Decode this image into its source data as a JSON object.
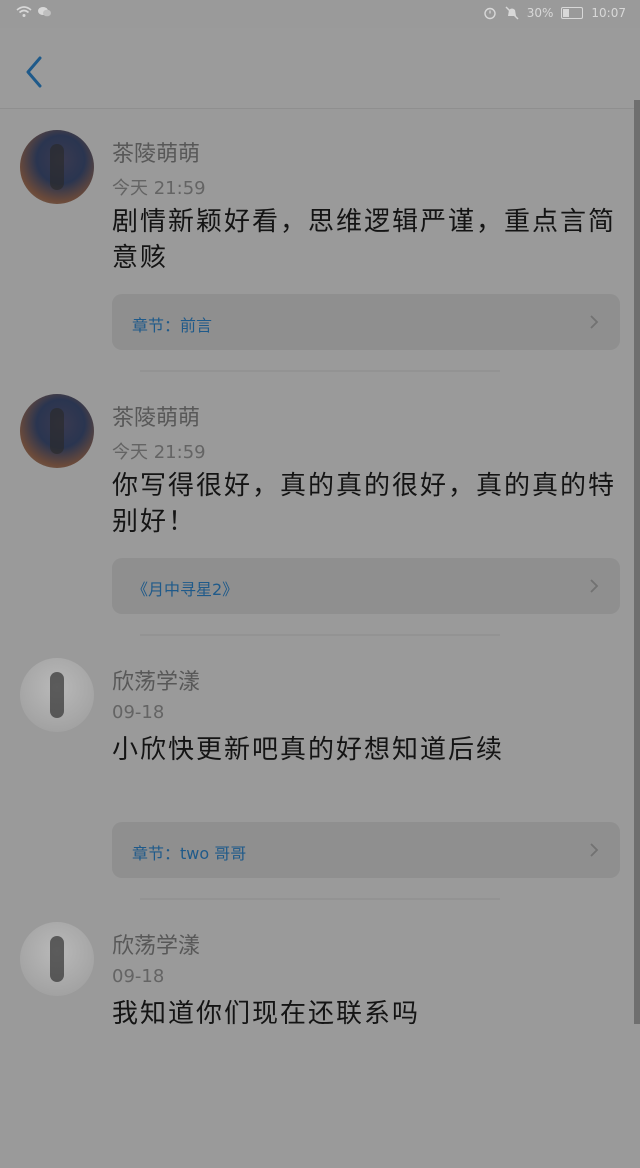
{
  "status": {
    "battery_percent": "30%",
    "time": "10:07"
  },
  "nav": {
    "back_icon": "chevron-left-icon"
  },
  "comments": [
    {
      "user": "茶陵萌萌",
      "time": "今天 21:59",
      "text": "剧情新颖好看，思维逻辑严谨，重点言简意赅",
      "chapter": "章节：前言"
    },
    {
      "user": "茶陵萌萌",
      "time": "今天 21:59",
      "text": "你写得很好，真的真的很好，真的真的特别好！",
      "chapter": "《月中寻星2》"
    },
    {
      "user": "欣荡学漾",
      "time": "09-18",
      "text": "小欣快更新吧真的好想知道后续",
      "chapter": "章节：two 哥哥"
    },
    {
      "user": "欣荡学漾",
      "time": "09-18",
      "text": "我知道你们现在还联系吗",
      "chapter": ""
    }
  ],
  "colors": {
    "accent": "#1f5a8a",
    "background": "#9a9a9a"
  }
}
